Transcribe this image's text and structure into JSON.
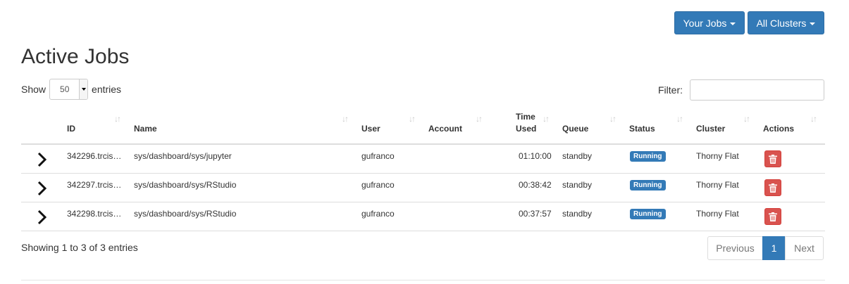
{
  "header": {
    "your_jobs_label": "Your Jobs",
    "all_clusters_label": "All Clusters"
  },
  "page": {
    "title": "Active Jobs"
  },
  "length_control": {
    "show_label": "Show",
    "value": "50",
    "entries_label": "entries"
  },
  "filter": {
    "label": "Filter:",
    "value": ""
  },
  "table": {
    "columns": [
      "ID",
      "Name",
      "User",
      "Account",
      "Time Used",
      "Queue",
      "Status",
      "Cluster",
      "Actions"
    ],
    "column_time_line1": "Time",
    "column_time_line2": "Used",
    "rows": [
      {
        "id": "342296.trcis…",
        "name": "sys/dashboard/sys/jupyter",
        "user": "gufranco",
        "account": "",
        "time_used": "01:10:00",
        "queue": "standby",
        "status": "Running",
        "cluster": "Thorny Flat"
      },
      {
        "id": "342297.trcis…",
        "name": "sys/dashboard/sys/RStudio",
        "user": "gufranco",
        "account": "",
        "time_used": "00:38:42",
        "queue": "standby",
        "status": "Running",
        "cluster": "Thorny Flat"
      },
      {
        "id": "342298.trcis…",
        "name": "sys/dashboard/sys/RStudio",
        "user": "gufranco",
        "account": "",
        "time_used": "00:37:57",
        "queue": "standby",
        "status": "Running",
        "cluster": "Thorny Flat"
      }
    ]
  },
  "info": {
    "text": "Showing 1 to 3 of 3 entries"
  },
  "pagination": {
    "previous": "Previous",
    "current": "1",
    "next": "Next"
  },
  "colors": {
    "primary": "#337ab7",
    "danger": "#d9534f"
  },
  "icons": {
    "expand": "chevron-right-icon",
    "delete": "trash-icon",
    "sort": "sort-icon",
    "dropdown": "caret-down-icon"
  }
}
